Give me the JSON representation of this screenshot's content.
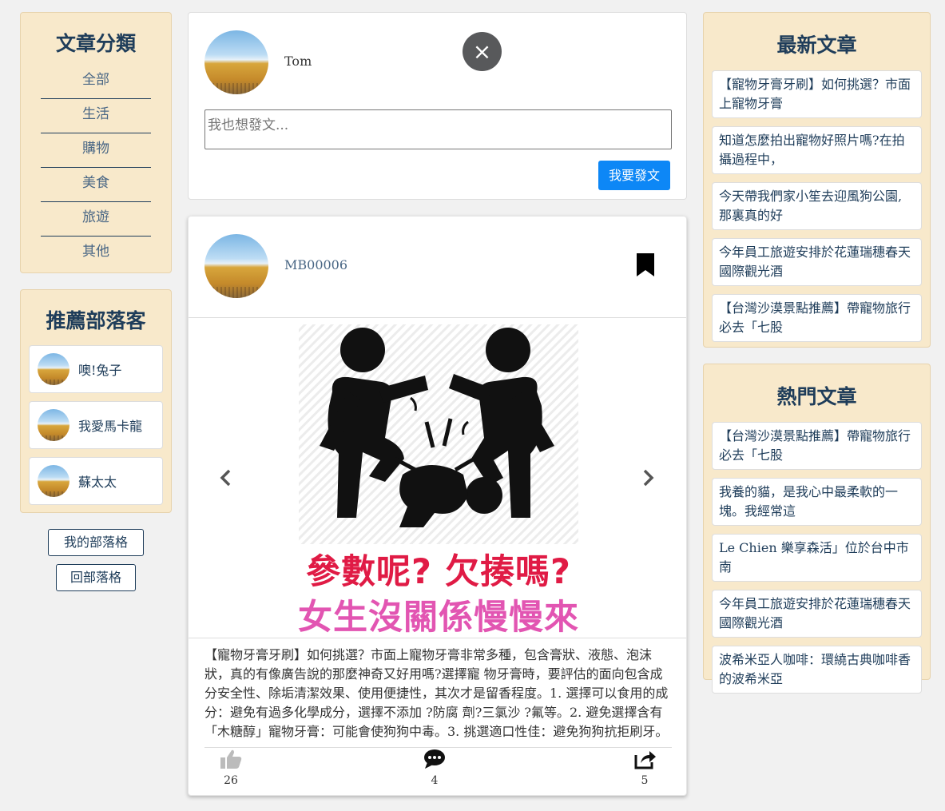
{
  "categories": {
    "title": "文章分類",
    "items": [
      "全部",
      "生活",
      "購物",
      "美食",
      "旅遊",
      "其他"
    ]
  },
  "bloggers": {
    "title": "推薦部落客",
    "items": [
      "噢!兔子",
      "我愛馬卡龍",
      "蘇太太"
    ]
  },
  "buttons": {
    "my_blog": "我的部落格",
    "back_blog": "回部落格"
  },
  "compose": {
    "user": "Tom",
    "close": "×",
    "placeholder": "我也想發文...",
    "submit": "我要發文"
  },
  "post": {
    "user": "MB00006",
    "image_text_1": "參數呢? 欠揍嗎?",
    "image_text_2": "女生沒關係慢慢來",
    "body": "【寵物牙膏牙刷】如何挑選？市面上寵物牙膏非常多種，包含膏狀、液態、泡沫狀，真的有像廣告說的那麼神奇又好用嗎?選擇寵 物牙膏時，要評估的面向包含成分安全性、除垢清潔效果、使用便捷性，其次才是留香程度。1. 選擇可以食用的成分：避免有過多化學成分，選擇不添加 ?防腐 劑?三氯沙 ?氟等。2. 避免選擇含有「木糖醇」寵物牙膏：可能會使狗狗中毒。3. 挑選適口性佳：避免狗狗抗拒刷牙。",
    "likes": "26",
    "comments": "4",
    "shares": "5"
  },
  "latest": {
    "title": "最新文章",
    "items": [
      "【寵物牙膏牙刷】如何挑選？市面上寵物牙膏",
      "知道怎麼拍出寵物好照片嗎?在拍攝過程中，",
      "今天帶我們家小笙去迎風狗公園,那裏真的好",
      "今年員工旅遊安排於花蓮瑞穗春天國際觀光酒",
      "【台灣沙漠景點推薦】帶寵物旅行必去「七股"
    ]
  },
  "hot": {
    "title": "熱門文章",
    "items": [
      "【台灣沙漠景點推薦】帶寵物旅行必去「七股",
      "我養的貓，是我心中最柔軟的一塊。我經常這",
      "Le Chien 樂享森活」位於台中市南",
      "今年員工旅遊安排於花蓮瑞穗春天國際觀光酒",
      "波希米亞人咖啡：環繞古典咖啡香的波希米亞"
    ]
  },
  "colors": {
    "panel_bg": "#f8e9cb",
    "title_navy": "#1f3d5a",
    "primary_button": "#0d87f6",
    "close_button": "#58595b"
  }
}
